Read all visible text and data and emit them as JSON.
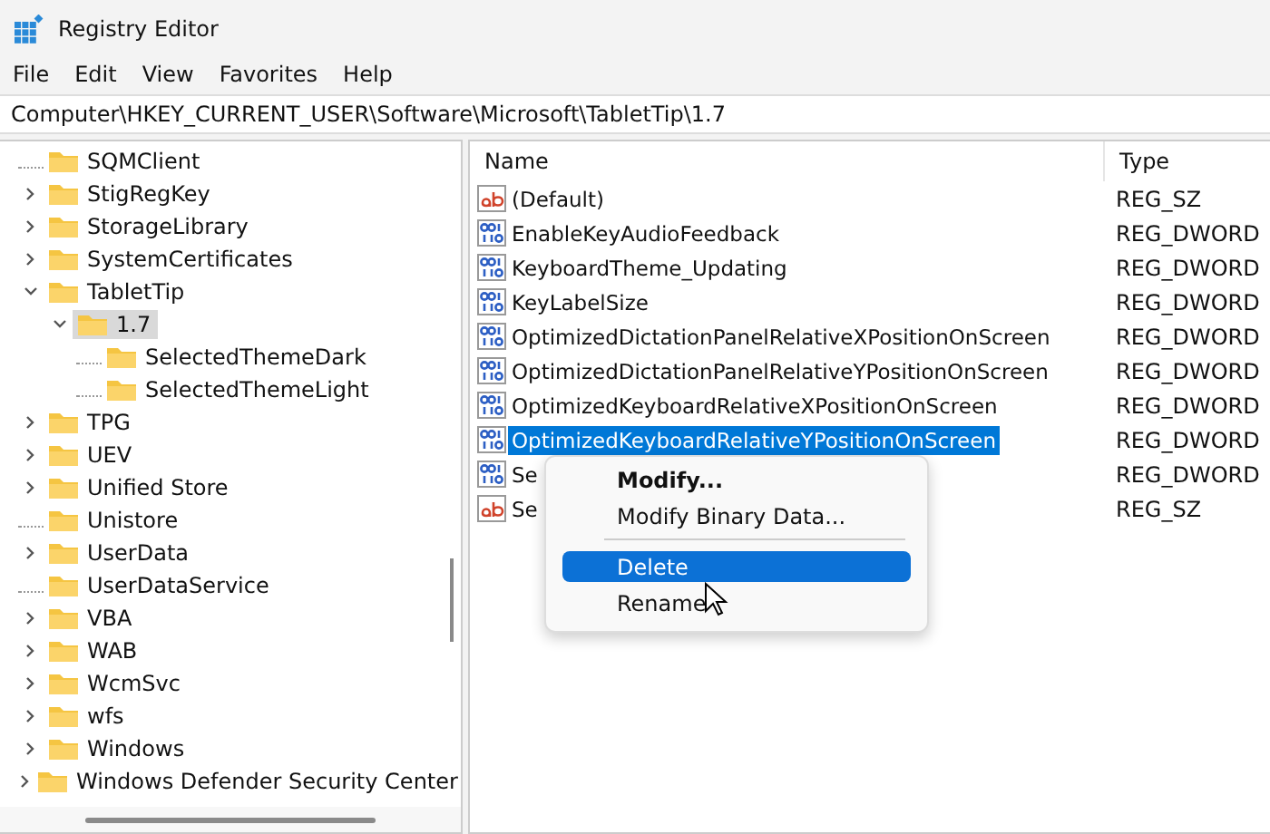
{
  "window": {
    "title": "Registry Editor"
  },
  "menu": [
    "File",
    "Edit",
    "View",
    "Favorites",
    "Help"
  ],
  "address": "Computer\\HKEY_CURRENT_USER\\Software\\Microsoft\\TabletTip\\1.7",
  "tree": [
    {
      "label": "SQMClient",
      "kind": "leaf",
      "selected": false
    },
    {
      "label": "StigRegKey",
      "kind": "branch",
      "expanded": false,
      "selected": false
    },
    {
      "label": "StorageLibrary",
      "kind": "branch",
      "expanded": false,
      "selected": false
    },
    {
      "label": "SystemCertificates",
      "kind": "branch",
      "expanded": false,
      "selected": false
    },
    {
      "label": "TabletTip",
      "kind": "branch",
      "expanded": true,
      "selected": false,
      "children": [
        {
          "label": "1.7",
          "kind": "branch",
          "expanded": true,
          "selected": true,
          "children": [
            {
              "label": "SelectedThemeDark",
              "kind": "leaf",
              "selected": false
            },
            {
              "label": "SelectedThemeLight",
              "kind": "leaf",
              "selected": false
            }
          ]
        }
      ]
    },
    {
      "label": "TPG",
      "kind": "branch",
      "expanded": false,
      "selected": false
    },
    {
      "label": "UEV",
      "kind": "branch",
      "expanded": false,
      "selected": false
    },
    {
      "label": "Unified Store",
      "kind": "branch",
      "expanded": false,
      "selected": false
    },
    {
      "label": "Unistore",
      "kind": "leaf",
      "selected": false
    },
    {
      "label": "UserData",
      "kind": "branch",
      "expanded": false,
      "selected": false
    },
    {
      "label": "UserDataService",
      "kind": "leaf",
      "selected": false
    },
    {
      "label": "VBA",
      "kind": "branch",
      "expanded": false,
      "selected": false
    },
    {
      "label": "WAB",
      "kind": "branch",
      "expanded": false,
      "selected": false
    },
    {
      "label": "WcmSvc",
      "kind": "branch",
      "expanded": false,
      "selected": false
    },
    {
      "label": "wfs",
      "kind": "branch",
      "expanded": false,
      "selected": false
    },
    {
      "label": "Windows",
      "kind": "branch",
      "expanded": false,
      "selected": false
    },
    {
      "label": "Windows Defender Security Center",
      "kind": "branch",
      "expanded": false,
      "selected": false
    }
  ],
  "table": {
    "columns": [
      "Name",
      "Type"
    ],
    "rows": [
      {
        "kind": "string",
        "name": "(Default)",
        "type": "REG_SZ",
        "selected": false
      },
      {
        "kind": "binary",
        "name": "EnableKeyAudioFeedback",
        "type": "REG_DWORD",
        "selected": false
      },
      {
        "kind": "binary",
        "name": "KeyboardTheme_Updating",
        "type": "REG_DWORD",
        "selected": false
      },
      {
        "kind": "binary",
        "name": "KeyLabelSize",
        "type": "REG_DWORD",
        "selected": false
      },
      {
        "kind": "binary",
        "name": "OptimizedDictationPanelRelativeXPositionOnScreen",
        "type": "REG_DWORD",
        "selected": false
      },
      {
        "kind": "binary",
        "name": "OptimizedDictationPanelRelativeYPositionOnScreen",
        "type": "REG_DWORD",
        "selected": false
      },
      {
        "kind": "binary",
        "name": "OptimizedKeyboardRelativeXPositionOnScreen",
        "type": "REG_DWORD",
        "selected": false
      },
      {
        "kind": "binary",
        "name": "OptimizedKeyboardRelativeYPositionOnScreen",
        "type": "REG_DWORD",
        "selected": true
      },
      {
        "kind": "binary",
        "name": "Se",
        "type": "REG_DWORD",
        "selected": false
      },
      {
        "kind": "string",
        "name": "Se",
        "type": "REG_SZ",
        "selected": false
      }
    ]
  },
  "context_menu": [
    {
      "kind": "item",
      "label": "Modify...",
      "bold": true,
      "selected": false
    },
    {
      "kind": "item",
      "label": "Modify Binary Data...",
      "bold": false,
      "selected": false
    },
    {
      "kind": "separator"
    },
    {
      "kind": "item",
      "label": "Delete",
      "bold": false,
      "selected": true
    },
    {
      "kind": "item",
      "label": "Rename",
      "bold": false,
      "selected": false
    }
  ]
}
